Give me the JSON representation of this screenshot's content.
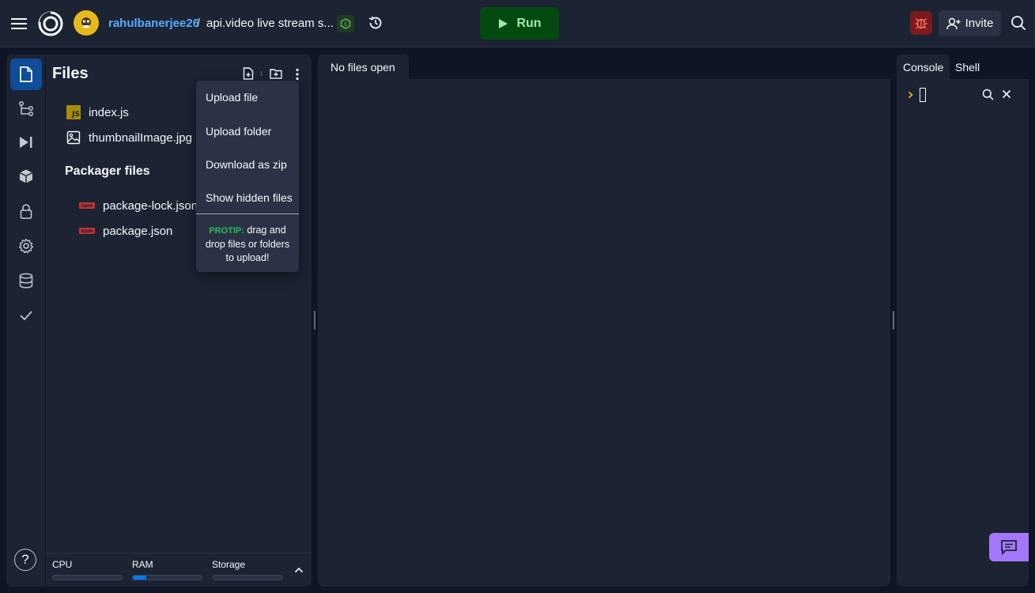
{
  "header": {
    "owner": "rahulbanerjee26",
    "separator": "/",
    "repl_name": "api.video live stream s...",
    "run_label": "Run",
    "invite_label": "Invite"
  },
  "files": {
    "title": "Files",
    "items": [
      {
        "name": "index.js",
        "icon": "js-file-icon",
        "badge": "JS"
      },
      {
        "name": "thumbnailImage.jpg",
        "icon": "image-file-icon"
      }
    ],
    "packager_title": "Packager files",
    "packager_items": [
      {
        "name": "package-lock.json",
        "icon": "npm-icon"
      },
      {
        "name": "package.json",
        "icon": "npm-icon"
      }
    ],
    "npm_badge": "npm"
  },
  "menu": {
    "items": [
      "Upload file",
      "Upload folder",
      "Download as zip",
      "Show hidden files"
    ],
    "protip_tag": "PROTIP:",
    "protip_text": " drag and drop files or folders to upload!"
  },
  "resources": {
    "cpu_label": "CPU",
    "ram_label": "RAM",
    "storage_label": "Storage",
    "cpu_level": 0.0,
    "ram_level": 0.2,
    "storage_level": 0.0
  },
  "editor": {
    "tab_label": "No files open"
  },
  "console": {
    "tabs": [
      "Console",
      "Shell"
    ],
    "active_tab": "Console"
  },
  "help_label": "?",
  "colors": {
    "accent": "#0f4c99",
    "owner_link": "#57abff",
    "run_bg": "#044a10",
    "protip": "#2bba5b",
    "chat_button": "#a378ff",
    "debug_bg": "#7a1b1b"
  }
}
